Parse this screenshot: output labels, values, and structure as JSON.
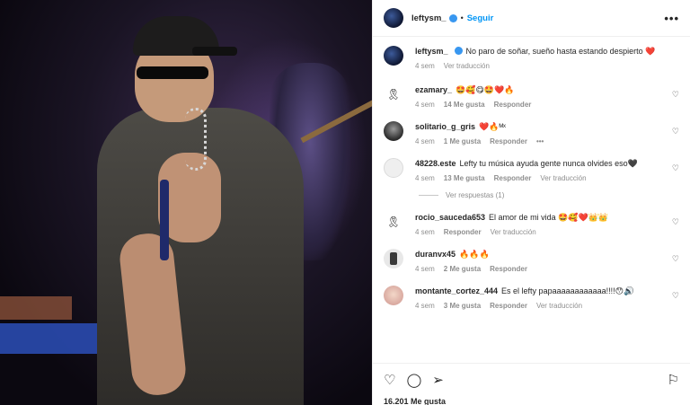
{
  "header": {
    "username": "leftysm_",
    "separator": "•",
    "follow_label": "Seguir",
    "more_label": "•••"
  },
  "caption": {
    "username": "leftysm_",
    "text": "No paro de soñar, sueño hasta estando despierto ❤️",
    "time": "4 sem",
    "translate": "Ver traducción"
  },
  "comments": [
    {
      "username": "ezamary_",
      "text": "🤩🥰😋🤩❤️🔥",
      "time": "4 sem",
      "likes": "14 Me gusta",
      "reply": "Responder",
      "avatar_icon": "ribbon-icon",
      "avatar_glyph": "🎗"
    },
    {
      "username": "solitario_g_gris",
      "text": "❤️🔥ᴹˣ",
      "time": "4 sem",
      "likes": "1 Me gusta",
      "reply": "Responder",
      "more": "•••",
      "avatar_icon": "user-photo-icon",
      "avatar_glyph": ""
    },
    {
      "username": "48228.este",
      "text": "Lefty tu música ayuda gente nunca olvides eso🖤",
      "time": "4 sem",
      "likes": "13 Me gusta",
      "reply": "Responder",
      "translate": "Ver traducción",
      "avatar_icon": "default-avatar-icon",
      "avatar_glyph": ""
    },
    {
      "username": "rocio_sauceda653",
      "text": "El amor de mi vida 🤩🥰❤️👑👑",
      "time": "4 sem",
      "reply": "Responder",
      "translate": "Ver traducción",
      "avatar_icon": "ribbon-icon",
      "avatar_glyph": "🎗"
    },
    {
      "username": "duranvx45",
      "text": "🔥🔥🔥",
      "time": "4 sem",
      "likes": "2 Me gusta",
      "reply": "Responder",
      "avatar_icon": "phone-photo-icon",
      "avatar_glyph": ""
    },
    {
      "username": "montante_cortez_444",
      "text": "Es el lefty papaaaaaaaaaaaa!!!!😯🔊⃝",
      "time": "4 sem",
      "likes": "3 Me gusta",
      "reply": "Responder",
      "translate": "Ver traducción",
      "avatar_icon": "cartoon-avatar-icon",
      "avatar_glyph": ""
    }
  ],
  "view_replies": "Ver respuestas (1)",
  "footer": {
    "likes": "16.201 Me gusta"
  },
  "colors": {
    "link_blue": "#0095f6",
    "meta_gray": "#8e8e8e",
    "verified_blue": "#3897f0"
  }
}
